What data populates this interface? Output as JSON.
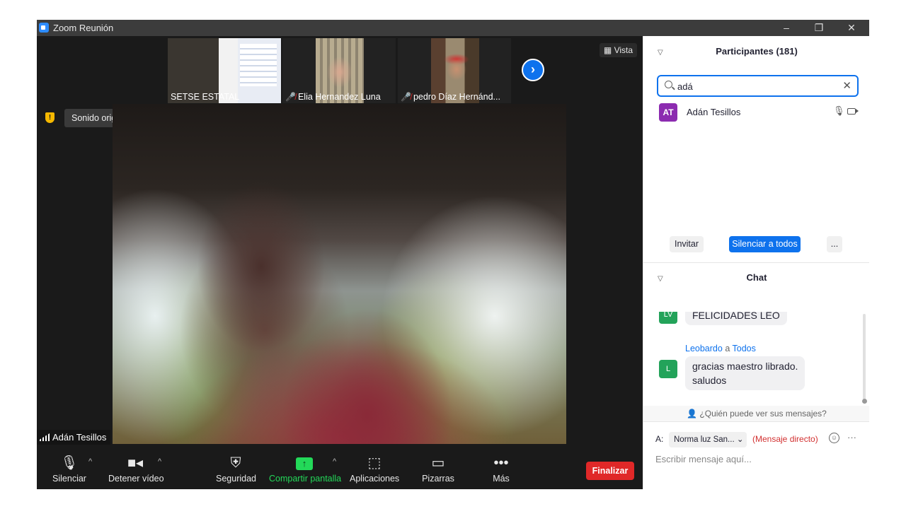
{
  "window": {
    "title": "Zoom Reunión",
    "controls": {
      "minimize": "–",
      "restore": "❐",
      "close": "✕"
    }
  },
  "stage": {
    "thumbnails": [
      {
        "name": "SETSE ESTATAL",
        "muted": false
      },
      {
        "name": "Elia Hernandez Luna",
        "muted": true
      },
      {
        "name": "pedro  Díaz Hernánd...",
        "muted": true
      }
    ],
    "next_arrow": "›",
    "view_label": "Vista",
    "original_sound_label": "Sonido original: desactivado",
    "speaker_name": "Adán Tesillos"
  },
  "toolbar": {
    "mute_label": "Silenciar",
    "video_label": "Detener vídeo",
    "security_label": "Seguridad",
    "share_label": "Compartir pantalla",
    "apps_label": "Aplicaciones",
    "whiteboards_label": "Pizarras",
    "more_label": "Más",
    "end_label": "Finalizar"
  },
  "participants": {
    "header": "Participantes (181)",
    "search_value": "adá",
    "list": [
      {
        "initials": "AT",
        "name": "Adán Tesillos"
      }
    ],
    "invite_label": "Invitar",
    "mute_all_label": "Silenciar a todos",
    "more_label": "..."
  },
  "chat": {
    "header": "Chat",
    "messages": [
      {
        "initials": "LV",
        "text": "FELICIDADES LEO"
      },
      {
        "initials": "L",
        "sender": "Leobardo",
        "connector": "a",
        "recipient": "Todos",
        "lines": [
          "gracias maestro librado.",
          "saludos"
        ]
      }
    ],
    "who_sees": "¿Quién puede ver sus mensajes?",
    "to_label": "A:",
    "recipient": "Norma luz San...",
    "direct_label": "(Mensaje directo)",
    "more_label": "···",
    "input_placeholder": "Escribir mensaje aquí..."
  },
  "colors": {
    "accent": "#0e72ed",
    "share_green": "#23d959",
    "end_red": "#e02828"
  }
}
